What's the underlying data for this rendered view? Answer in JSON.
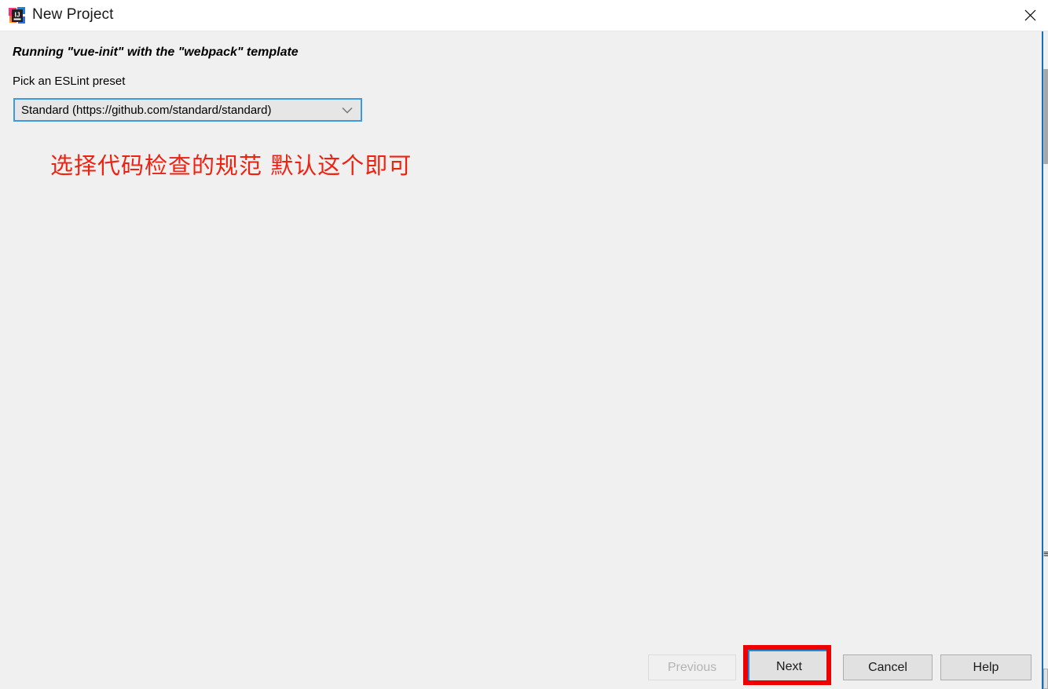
{
  "window": {
    "title": "New Project",
    "app_icon": "intellij-idea-icon",
    "close_icon": "close-icon",
    "background_color": "#f0f0f0",
    "titlebar_color": "#ffffff"
  },
  "body": {
    "running_line": "Running \"vue-init\" with the \"webpack\" template",
    "pick_label": "Pick an ESLint preset",
    "preset_select": {
      "value": "Standard (https://github.com/standard/standard)",
      "arrow_icon": "chevron-down-icon",
      "focus_color": "#3e9ae0"
    }
  },
  "annotations": {
    "note_text": "选择代码检查的规范 默认这个即可",
    "note_color": "#ee2211",
    "highlight_color": "#ee0000",
    "highlight_target": "Next"
  },
  "buttons": {
    "previous": {
      "label": "Previous",
      "enabled": false
    },
    "next": {
      "label": "Next",
      "enabled": true,
      "focused": true,
      "focus_color": "#1a8cd8"
    },
    "cancel": {
      "label": "Cancel",
      "enabled": true
    },
    "help": {
      "label": "Help",
      "enabled": true
    }
  },
  "right_edge": {
    "divider_color": "#1271c0",
    "scrollbar_thumb_color": "#a8a8a8",
    "clipped_text": "≡"
  }
}
